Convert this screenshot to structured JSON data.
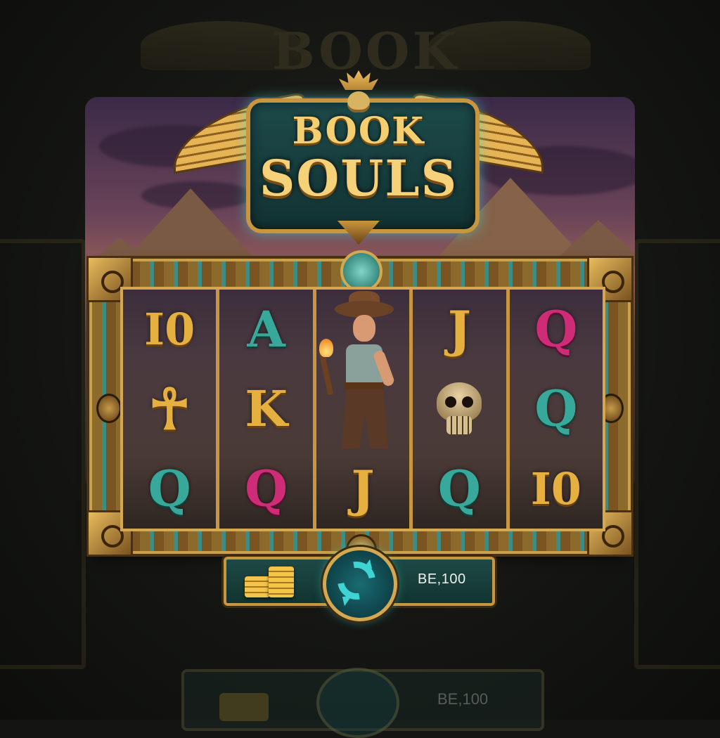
{
  "game": {
    "title_line1": "BOOK",
    "title_line2": "SOULS"
  },
  "reels": [
    [
      {
        "symbol": "10",
        "color": "gold"
      },
      {
        "symbol": "☥",
        "color": "gold"
      },
      {
        "symbol": "Q",
        "color": "teal"
      }
    ],
    [
      {
        "symbol": "A",
        "color": "teal"
      },
      {
        "symbol": "K",
        "color": "gold"
      },
      {
        "symbol": "Q",
        "color": "pink"
      }
    ],
    [
      {
        "symbol": "explorer",
        "color": "wild"
      },
      {
        "symbol": "J",
        "color": "gold"
      }
    ],
    [
      {
        "symbol": "J",
        "color": "gold"
      },
      {
        "symbol": "skull",
        "color": "scatter"
      },
      {
        "symbol": "Q",
        "color": "teal"
      }
    ],
    [
      {
        "symbol": "Q",
        "color": "pink"
      },
      {
        "symbol": "Q",
        "color": "teal"
      },
      {
        "symbol": "10",
        "color": "gold"
      }
    ]
  ],
  "controls": {
    "balance": "BE,100",
    "spin_icon": "refresh-icon",
    "coins_icon": "coin-stack-icon"
  },
  "colors": {
    "gold": "#e6b040",
    "teal": "#37a89a",
    "pink": "#cf2c78",
    "accent": "#3fd4d4"
  },
  "background_echo": {
    "title": "BOOK",
    "balance": "BE,100"
  }
}
